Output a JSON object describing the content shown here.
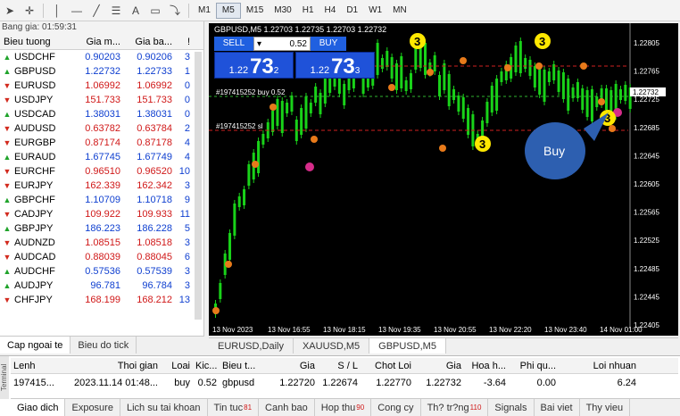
{
  "toolbar": {
    "timeframes": [
      "M1",
      "M5",
      "M15",
      "M30",
      "H1",
      "H4",
      "D1",
      "W1",
      "MN"
    ],
    "active_timeframe": "M5"
  },
  "market_watch": {
    "title": "Bang gia: 01:59:31",
    "headers": {
      "symbol": "Bieu tuong",
      "bid": "Gia m...",
      "ask": "Gia ba...",
      "spread": "!"
    },
    "rows": [
      {
        "symbol": "USDCHF",
        "bid": "0.90203",
        "ask": "0.90206",
        "spread": "3",
        "dir": "up"
      },
      {
        "symbol": "GBPUSD",
        "bid": "1.22732",
        "ask": "1.22733",
        "spread": "1",
        "dir": "up"
      },
      {
        "symbol": "EURUSD",
        "bid": "1.06992",
        "ask": "1.06992",
        "spread": "0",
        "dir": "down"
      },
      {
        "symbol": "USDJPY",
        "bid": "151.733",
        "ask": "151.733",
        "spread": "0",
        "dir": "down"
      },
      {
        "symbol": "USDCAD",
        "bid": "1.38031",
        "ask": "1.38031",
        "spread": "0",
        "dir": "up"
      },
      {
        "symbol": "AUDUSD",
        "bid": "0.63782",
        "ask": "0.63784",
        "spread": "2",
        "dir": "down"
      },
      {
        "symbol": "EURGBP",
        "bid": "0.87174",
        "ask": "0.87178",
        "spread": "4",
        "dir": "down"
      },
      {
        "symbol": "EURAUD",
        "bid": "1.67745",
        "ask": "1.67749",
        "spread": "4",
        "dir": "up"
      },
      {
        "symbol": "EURCHF",
        "bid": "0.96510",
        "ask": "0.96520",
        "spread": "10",
        "dir": "down"
      },
      {
        "symbol": "EURJPY",
        "bid": "162.339",
        "ask": "162.342",
        "spread": "3",
        "dir": "down"
      },
      {
        "symbol": "GBPCHF",
        "bid": "1.10709",
        "ask": "1.10718",
        "spread": "9",
        "dir": "up"
      },
      {
        "symbol": "CADJPY",
        "bid": "109.922",
        "ask": "109.933",
        "spread": "11",
        "dir": "down"
      },
      {
        "symbol": "GBPJPY",
        "bid": "186.223",
        "ask": "186.228",
        "spread": "5",
        "dir": "up"
      },
      {
        "symbol": "AUDNZD",
        "bid": "1.08515",
        "ask": "1.08518",
        "spread": "3",
        "dir": "down"
      },
      {
        "symbol": "AUDCAD",
        "bid": "0.88039",
        "ask": "0.88045",
        "spread": "6",
        "dir": "down"
      },
      {
        "symbol": "AUDCHF",
        "bid": "0.57536",
        "ask": "0.57539",
        "spread": "3",
        "dir": "up"
      },
      {
        "symbol": "AUDJPY",
        "bid": "96.781",
        "ask": "96.784",
        "spread": "3",
        "dir": "up"
      },
      {
        "symbol": "CHFJPY",
        "bid": "168.199",
        "ask": "168.212",
        "spread": "13",
        "dir": "down"
      }
    ],
    "tabs": [
      "Cap ngoai te",
      "Bieu do tick"
    ]
  },
  "chart": {
    "title": "GBPUSD,M5  1.22703 1.22735 1.22703 1.22732",
    "sell_label": "SELL",
    "buy_label": "BUY",
    "lot": "0.52",
    "sell_price_small": "1.22",
    "sell_price_big": "73",
    "sell_price_sup": "2",
    "buy_price_small": "1.22",
    "buy_price_big": "73",
    "buy_price_sup": "3",
    "order_label_1": "#197415252 buy 0.52",
    "order_label_2": "#197415252 sl",
    "callout": "Buy",
    "marker_label": "3",
    "price_tag": "1.22732",
    "price_axis": [
      "1.22805",
      "1.22765",
      "1.22725",
      "1.22685",
      "1.22645",
      "1.22605",
      "1.22565",
      "1.22525",
      "1.22485",
      "1.22445",
      "1.22405"
    ],
    "time_axis": [
      "13 Nov 2023",
      "13 Nov 16:55",
      "13 Nov 18:15",
      "13 Nov 19:35",
      "13 Nov 20:55",
      "13 Nov 22:20",
      "13 Nov 23:40",
      "14 Nov 01:00"
    ],
    "colors": {
      "candle": "#19d219",
      "buy_line": "#2fb52f",
      "sl_line": "#d01f1f",
      "tp_line": "#d01f1f",
      "marker": "#e87a1a",
      "callout": "#2d5fb0"
    }
  },
  "chart_tabs": [
    "EURUSD,Daily",
    "XAUUSD,M5",
    "GBPUSD,M5"
  ],
  "terminal": {
    "side_label": "Terminal",
    "headers": [
      "Lenh",
      "Thoi gian",
      "Loai",
      "Kic...",
      "Bieu t...",
      "Gia",
      "S / L",
      "Chot Loi",
      "Gia",
      "Hoa h...",
      "Phi qu...",
      "Loi nhuan"
    ],
    "row": [
      "197415...",
      "2023.11.14 01:48...",
      "buy",
      "0.52",
      "gbpusd",
      "1.22720",
      "1.22674",
      "1.22770",
      "1.22732",
      "-3.64",
      "0.00",
      "6.24"
    ],
    "tabs": [
      {
        "label": "Giao dich",
        "badge": ""
      },
      {
        "label": "Exposure",
        "badge": ""
      },
      {
        "label": "Lich su tai khoan",
        "badge": ""
      },
      {
        "label": "Tin tuc",
        "badge": "81"
      },
      {
        "label": "Canh bao",
        "badge": ""
      },
      {
        "label": "Hop thu",
        "badge": "90"
      },
      {
        "label": "Cong cy",
        "badge": ""
      },
      {
        "label": "Th? tr?ng",
        "badge": "110"
      },
      {
        "label": "Signals",
        "badge": ""
      },
      {
        "label": "Bai viet",
        "badge": ""
      },
      {
        "label": "Thy vieu",
        "badge": ""
      }
    ]
  }
}
